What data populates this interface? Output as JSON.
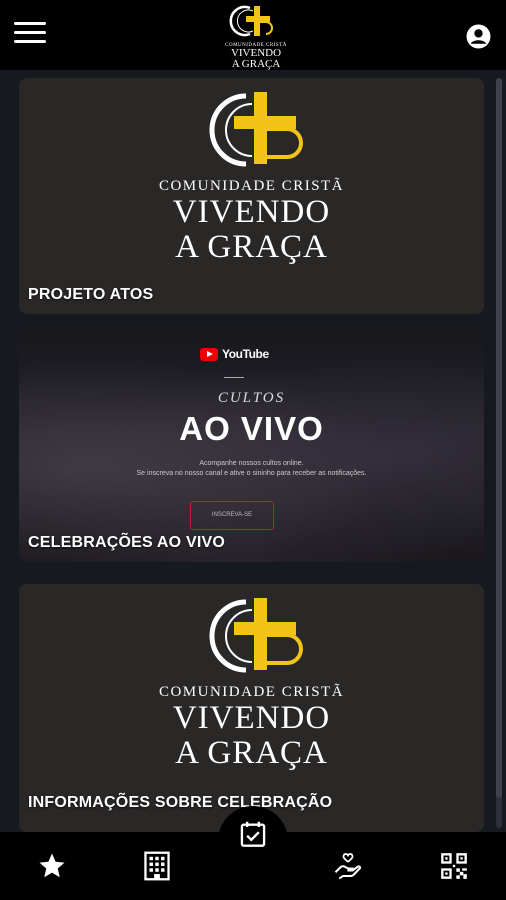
{
  "app": {
    "logo_small": {
      "sub": "COMUNIDADE CRISTÃ",
      "line1": "VIVENDO",
      "line2": "A GRAÇA"
    }
  },
  "cards": [
    {
      "title": "PROJETO ATOS",
      "brand": {
        "sub": "COMUNIDADE CRISTÃ",
        "line1": "VIVENDO",
        "line2": "A GRAÇA"
      }
    },
    {
      "title": "CELEBRAÇÕES AO VIVO",
      "live": {
        "youtube": "YouTube",
        "cultos": "CULTOS",
        "headline": "AO VIVO",
        "desc1": "Acompanhe nossos cultos online.",
        "desc2": "Se inscreva no nosso canal e ative o sininho para receber as notificações.",
        "button": "INSCREVA-SE"
      }
    },
    {
      "title": "INFORMAÇÕES SOBRE CELEBRAÇÃO",
      "brand": {
        "sub": "COMUNIDADE CRISTÃ",
        "line1": "VIVENDO",
        "line2": "A GRAÇA"
      }
    }
  ],
  "bottom_nav": {
    "items": [
      {
        "icon": "star-icon"
      },
      {
        "icon": "building-icon"
      },
      {
        "icon": "calendar-check-icon"
      },
      {
        "icon": "hand-heart-icon"
      },
      {
        "icon": "qr-code-icon"
      }
    ]
  },
  "colors": {
    "brand_gold": "#f2c418",
    "header_bg": "#000000",
    "card_bg": "#2a2727"
  }
}
